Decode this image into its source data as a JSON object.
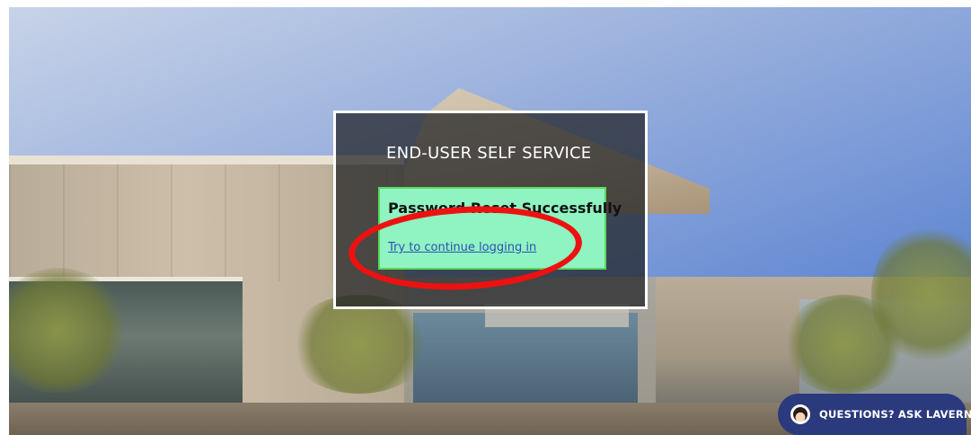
{
  "dialog": {
    "title": "END-USER SELF SERVICE",
    "success_heading": "Password Reset Successfully",
    "continue_link": "Try to continue logging in"
  },
  "chat": {
    "label": "QUESTIONS? ASK LAVERN",
    "avatar_icon": "lavern-avatar-icon",
    "color": "#2b3a7d"
  },
  "annotation": {
    "color": "#ee1111"
  },
  "colors": {
    "success_bg": "#8ff4c1",
    "success_border": "#5ad85c",
    "link": "#2f4fb4"
  }
}
